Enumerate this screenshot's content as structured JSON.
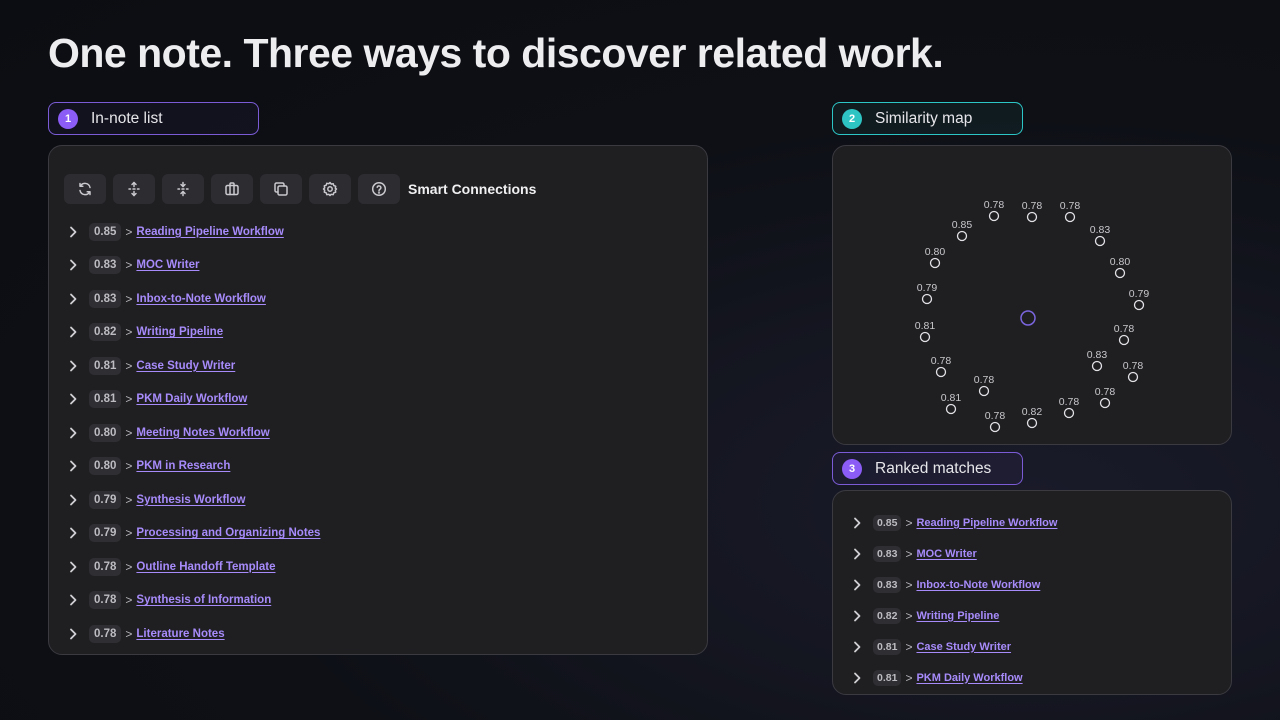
{
  "headline": "One note. Three ways to discover related work.",
  "sections": {
    "in_note": {
      "num": "1",
      "label": "In-note list"
    },
    "map": {
      "num": "2",
      "label": "Similarity map"
    },
    "ranked": {
      "num": "3",
      "label": "Ranked matches"
    }
  },
  "toolbar": {
    "title": "Smart Connections",
    "buttons": [
      "refresh-icon",
      "expand-vertical-icon",
      "collapse-vertical-icon",
      "briefcase-icon",
      "copy-icon",
      "gear-icon",
      "help-icon"
    ]
  },
  "separator": ">",
  "connections": [
    {
      "score": "0.85",
      "title": "Reading Pipeline Workflow"
    },
    {
      "score": "0.83",
      "title": "MOC Writer"
    },
    {
      "score": "0.83",
      "title": "Inbox-to-Note Workflow"
    },
    {
      "score": "0.82",
      "title": "Writing Pipeline"
    },
    {
      "score": "0.81",
      "title": "Case Study Writer"
    },
    {
      "score": "0.81",
      "title": "PKM Daily Workflow"
    },
    {
      "score": "0.80",
      "title": "Meeting Notes Workflow"
    },
    {
      "score": "0.80",
      "title": "PKM in Research"
    },
    {
      "score": "0.79",
      "title": "Synthesis Workflow"
    },
    {
      "score": "0.79",
      "title": "Processing and Organizing Notes"
    },
    {
      "score": "0.78",
      "title": "Outline Handoff Template"
    },
    {
      "score": "0.78",
      "title": "Synthesis of Information"
    },
    {
      "score": "0.78",
      "title": "Literature Notes"
    }
  ],
  "ranked": [
    {
      "score": "0.85",
      "title": "Reading Pipeline Workflow"
    },
    {
      "score": "0.83",
      "title": "MOC Writer"
    },
    {
      "score": "0.83",
      "title": "Inbox-to-Note Workflow"
    },
    {
      "score": "0.82",
      "title": "Writing Pipeline"
    },
    {
      "score": "0.81",
      "title": "Case Study Writer"
    },
    {
      "score": "0.81",
      "title": "PKM Daily Workflow"
    }
  ],
  "map_nodes": [
    "0.78",
    "0.78",
    "0.78",
    "0.85",
    "0.83",
    "0.80",
    "0.80",
    "0.79",
    "0.79",
    "0.81",
    "0.78",
    "0.78",
    "0.83",
    "0.78",
    "0.78",
    "0.78",
    "0.81",
    "0.82",
    "0.78",
    "0.78"
  ],
  "colors": {
    "accent": "#8b5cf6",
    "teal": "#2ec4c4",
    "link": "#a78bfa"
  }
}
